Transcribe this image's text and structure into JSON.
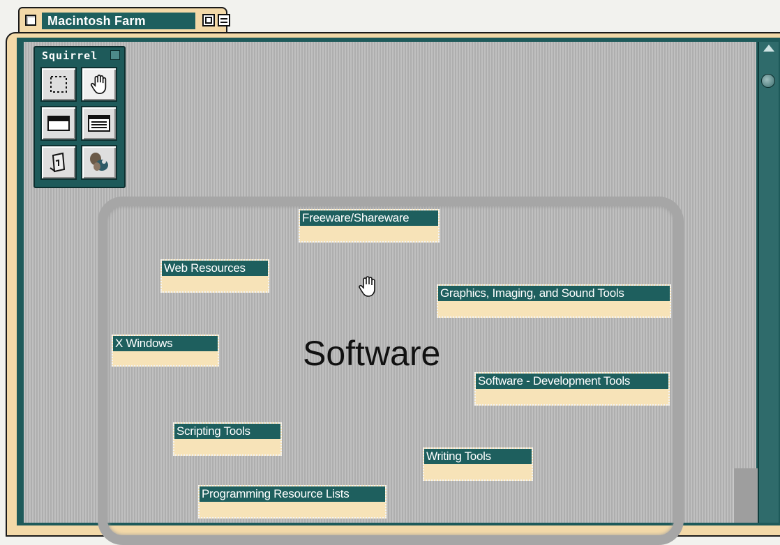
{
  "window": {
    "title": "Macintosh Farm",
    "accent_color": "#1e5f5e",
    "tab_color": "#f3d9a8"
  },
  "palette": {
    "title": "Squirrel",
    "tools": [
      {
        "icon": "marquee-select-icon",
        "selected": false
      },
      {
        "icon": "hand-grab-icon",
        "selected": true
      },
      {
        "icon": "window-title-icon",
        "selected": false
      },
      {
        "icon": "window-list-icon",
        "selected": false
      },
      {
        "icon": "document-icon",
        "selected": false
      },
      {
        "icon": "squirrel-icon",
        "selected": false
      }
    ]
  },
  "canvas": {
    "group_title": "Software",
    "nodes": [
      {
        "label": "Freeware/Shareware"
      },
      {
        "label": "Web Resources"
      },
      {
        "label": "Graphics, Imaging, and Sound Tools"
      },
      {
        "label": "X Windows"
      },
      {
        "label": "Software - Development Tools"
      },
      {
        "label": "Scripting Tools"
      },
      {
        "label": "Writing Tools"
      },
      {
        "label": "Programming Resource Lists"
      }
    ]
  }
}
